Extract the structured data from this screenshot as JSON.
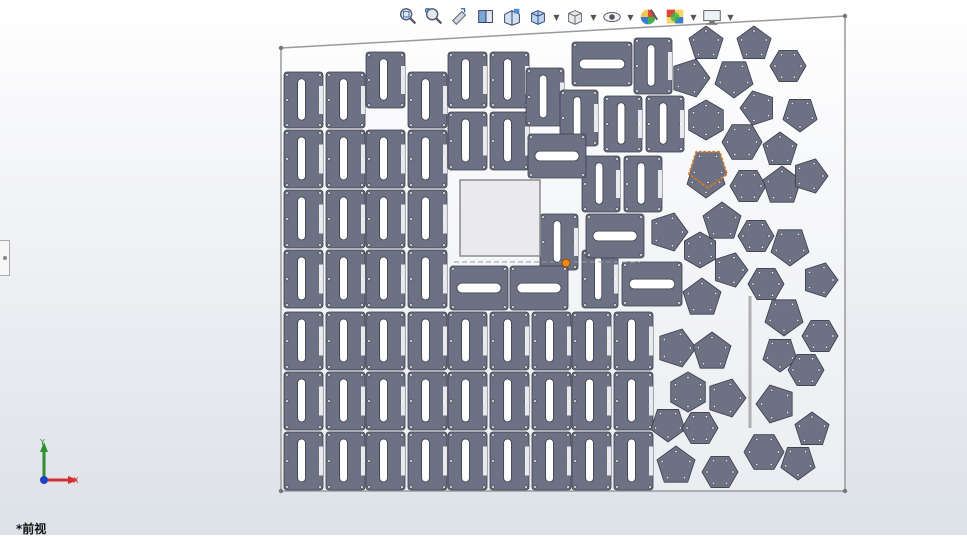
{
  "toolbar": {
    "tools": [
      {
        "icon": "zoom-to-fit-icon",
        "has_menu": false
      },
      {
        "icon": "zoom-to-area-icon",
        "has_menu": false
      },
      {
        "icon": "previous-view-icon",
        "has_menu": false
      },
      {
        "icon": "section-view-icon",
        "has_menu": false
      },
      {
        "icon": "dynamic-annotation-icon",
        "has_menu": false
      },
      {
        "icon": "view-orientation-icon",
        "has_menu": true
      },
      {
        "icon": "display-style-icon",
        "has_menu": true
      },
      {
        "icon": "hide-show-items-icon",
        "has_menu": true
      },
      {
        "icon": "edit-appearance-icon",
        "has_menu": false
      },
      {
        "icon": "apply-scene-icon",
        "has_menu": true
      },
      {
        "icon": "view-settings-icon",
        "has_menu": true
      }
    ]
  },
  "viewport": {
    "view_name": "*前视",
    "triad": {
      "y_label": "Y",
      "x_label": "X"
    },
    "colors": {
      "part_fill": "#6d7184",
      "part_stroke": "#3a3d4a",
      "sheet_stroke": "#9a9a9a",
      "selected_stroke": "#d07a2a",
      "origin_marker": "#ef8a18",
      "triad_y": "#2f8f2f",
      "triad_x": "#d03030",
      "triad_z": "#2040c0"
    }
  }
}
